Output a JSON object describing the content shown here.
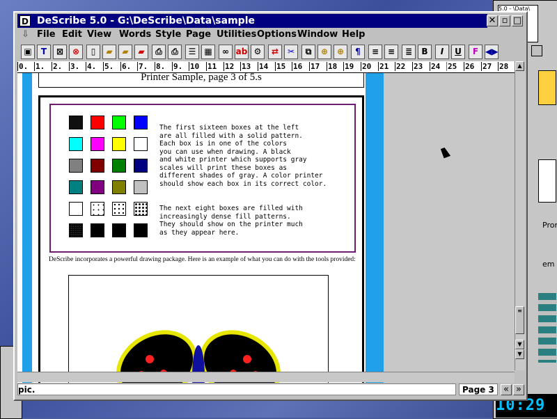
{
  "window": {
    "title": "DeScribe 5.0 - G:\\DeScribe\\Data\\sample",
    "sys_icon_glyph": "D"
  },
  "menu": [
    "File",
    "Edit",
    "View",
    "Words",
    "Style",
    "Page",
    "Utilities",
    "Options",
    "Window",
    "Help"
  ],
  "ruler_ticks": [
    "0.",
    "1.",
    "2.",
    "3.",
    "4.",
    "5.",
    "6.",
    "7.",
    "8.",
    "9.",
    "10",
    "11",
    "12",
    "13",
    "14",
    "15",
    "16",
    "17",
    "18",
    "19",
    "20",
    "21",
    "22",
    "23",
    "24",
    "25",
    "26",
    "27",
    "28"
  ],
  "document": {
    "page_header": "Printer Sample, page 3 of 5.s",
    "paragraph1": "The first sixteen boxes at the left\nare all filled with a solid pattern.\nEach box is in one of the colors\nyou can use when drawing. A black\nand white printer which supports gray\nscales will print these boxes as\ndifferent shades of gray. A color printer\nshould show each box in its correct color.",
    "paragraph2": "The next eight boxes are filled with\nincreasingly dense fill patterns.\nThey should show on the printer much\nas they appear here.",
    "body_text": "DeScribe incorporates a powerful drawing package. Here is an example of what you can do with the tools provided:",
    "colors": [
      "#101010",
      "#ff0000",
      "#00ff00",
      "#0000ff",
      "#00ffff",
      "#ff00ff",
      "#ffff00",
      "#ffffff",
      "#808080",
      "#800000",
      "#008000",
      "#000080",
      "#008080",
      "#800080",
      "#808000",
      "#c0c0c0"
    ]
  },
  "status": {
    "left": "pic.",
    "page": "Page 3"
  },
  "desktop": {
    "clock": "10:29",
    "bg_title": "5.0 - \\Data\\"
  }
}
